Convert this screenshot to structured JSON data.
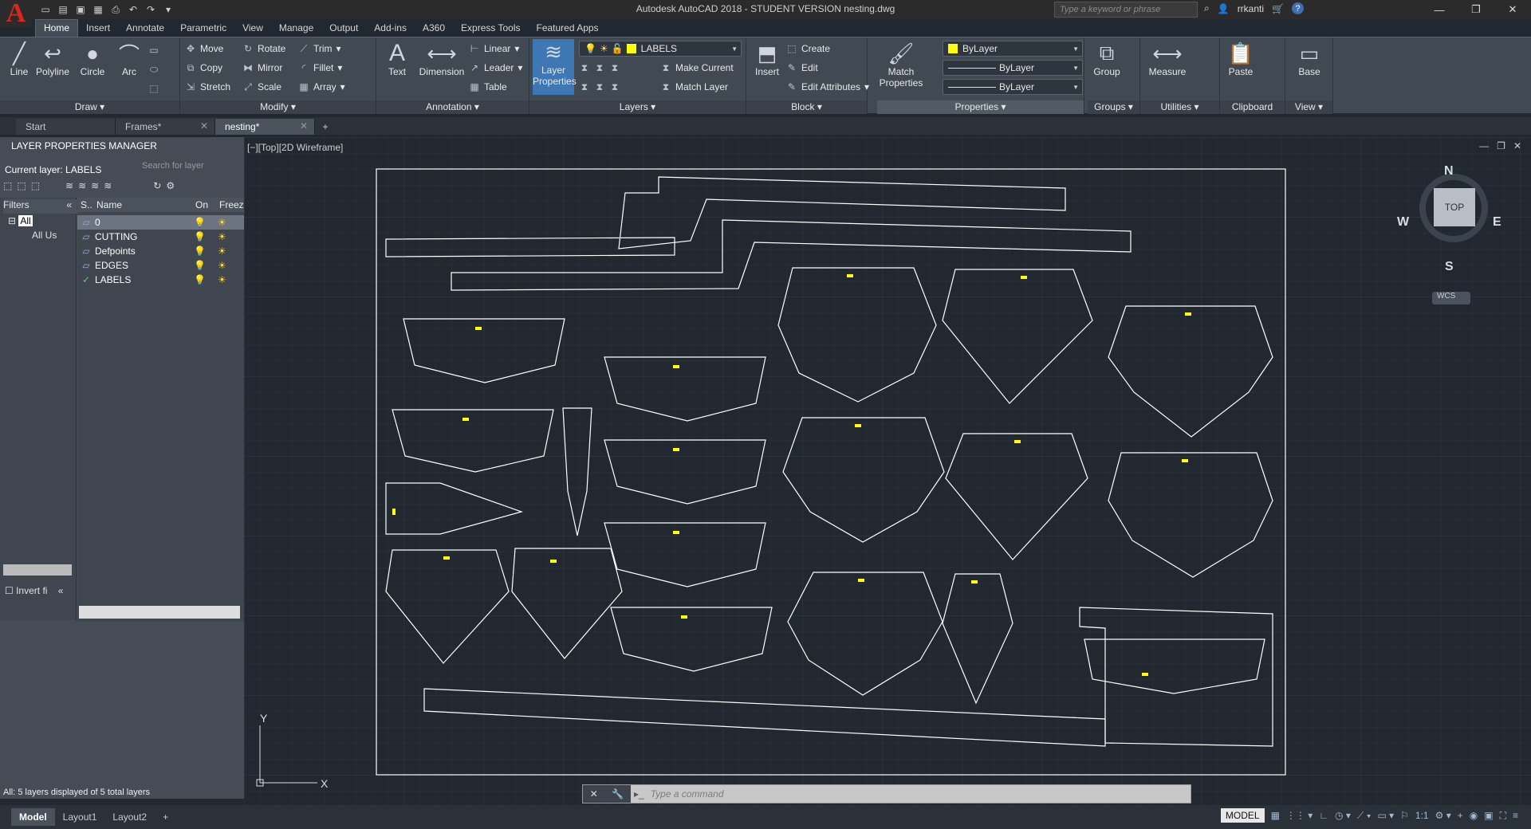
{
  "window": {
    "title": "Autodesk AutoCAD 2018 - STUDENT VERSION    nesting.dwg",
    "search_placeholder": "Type a keyword or phrase",
    "user": "rrkanti"
  },
  "ribbon_tabs": [
    "Home",
    "Insert",
    "Annotate",
    "Parametric",
    "View",
    "Manage",
    "Output",
    "Add-ins",
    "A360",
    "Express Tools",
    "Featured Apps"
  ],
  "ribbon": {
    "draw": {
      "title": "Draw",
      "line": "Line",
      "polyline": "Polyline",
      "circle": "Circle",
      "arc": "Arc"
    },
    "modify": {
      "title": "Modify",
      "move": "Move",
      "rotate": "Rotate",
      "trim": "Trim",
      "copy": "Copy",
      "mirror": "Mirror",
      "fillet": "Fillet",
      "stretch": "Stretch",
      "scale": "Scale",
      "array": "Array"
    },
    "annotation": {
      "title": "Annotation",
      "text": "Text",
      "dimension": "Dimension",
      "linear": "Linear",
      "leader": "Leader",
      "table": "Table"
    },
    "layers": {
      "title": "Layers",
      "layer_properties": "Layer Properties",
      "current_layer": "LABELS",
      "make_current": "Make Current",
      "match_layer": "Match Layer"
    },
    "block": {
      "title": "Block",
      "insert": "Insert",
      "create": "Create",
      "edit": "Edit",
      "edit_attributes": "Edit Attributes"
    },
    "properties": {
      "title": "Properties",
      "match_properties": "Match Properties",
      "color": "ByLayer",
      "linetype": "ByLayer",
      "lineweight": "ByLayer"
    },
    "groups": {
      "title": "Groups",
      "group": "Group"
    },
    "utilities": {
      "title": "Utilities",
      "measure": "Measure"
    },
    "clipboard": {
      "title": "Clipboard",
      "paste": "Paste"
    },
    "view": {
      "title": "View",
      "base": "Base"
    }
  },
  "doc_tabs": [
    {
      "label": "Start"
    },
    {
      "label": "Frames*"
    },
    {
      "label": "nesting*"
    }
  ],
  "layer_manager": {
    "header": "LAYER PROPERTIES MANAGER",
    "current_layer": "Current layer: LABELS",
    "search_placeholder": "Search for layer",
    "filters_label": "Filters",
    "filter_all": "All",
    "filter_all_used": "All Us",
    "columns": {
      "status": "S..",
      "name": "Name",
      "on": "On",
      "freeze": "Freez"
    },
    "layers": [
      "0",
      "CUTTING",
      "Defpoints",
      "EDGES",
      "LABELS"
    ],
    "invert_filter": "Invert fi",
    "status": "All: 5 layers displayed of 5 total layers"
  },
  "viewport": {
    "label": "[−][Top][2D Wireframe]",
    "viewcube_top": "TOP",
    "compass": {
      "n": "N",
      "s": "S",
      "e": "E",
      "w": "W"
    },
    "wcs": "WCS",
    "ucs_x": "X",
    "ucs_y": "Y"
  },
  "command": {
    "placeholder": "Type  a  command"
  },
  "statusbar": {
    "layouts": [
      "Model",
      "Layout1",
      "Layout2"
    ],
    "model": "MODEL",
    "scale": "1:1"
  }
}
